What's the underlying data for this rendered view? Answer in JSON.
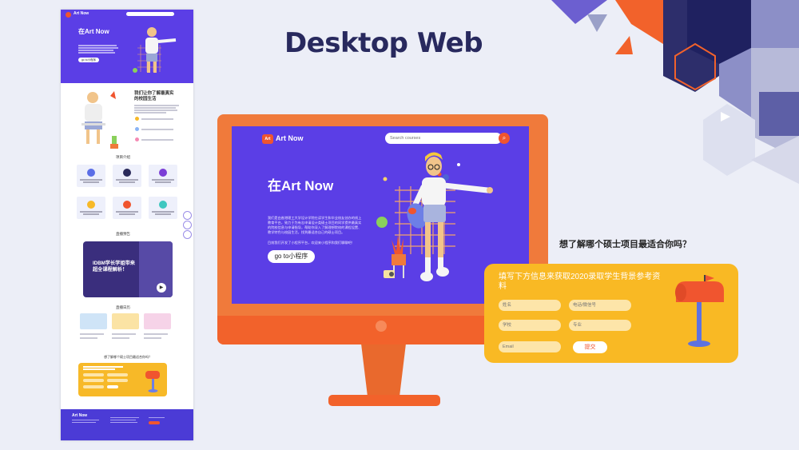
{
  "headline": "Desktop Web",
  "long_page": {
    "brand": "Art Now",
    "hero_title": "在Art Now",
    "hero_button": "go to小程序",
    "intro_title": "我们让你了解最真实的校园生活",
    "programs_title": "项目介绍",
    "live_title": "直播预告",
    "video_text_line1": "IDBM学长学姐带来",
    "video_text_line2": "超全课程解析！",
    "blog_title": "直播日历",
    "quiz_title": "想了解哪个硕士项目最适合你吗？",
    "footer_brand": "Art Now"
  },
  "screen": {
    "logo_text": "Art",
    "brand": "Art Now",
    "search_placeholder": "Search courses",
    "hero_title": "在Art Now",
    "hero_desc": "我们是由香港理工大学设计学院在读学生和毕业校友创办的线上教育平台，致力于为有志申请设计类硕士项目的同学提供最真实的院校信息与申请指导，帮助你深入了解理想院校的课程设置、教学特色与校园生活，找到最适合自己的硕士项目。",
    "hero_note": "目前我们开发了小程序平台，欢迎来小程序和我们聊聊吧！",
    "cta": "go to小程序"
  },
  "form": {
    "question": "想了解哪个硕士项目最适合你吗？",
    "title": "填写下方信息来获取2020录取学生背景参考资料",
    "name_placeholder": "姓名",
    "phone_placeholder": "电话/微信号",
    "school_placeholder": "学校",
    "major_placeholder": "专业",
    "email_placeholder": "Email",
    "submit": "提交"
  },
  "colors": {
    "purple": "#5b3ee6",
    "orange": "#f07a3b",
    "yellow": "#f9b924",
    "navy": "#28295e",
    "accent_red": "#f0552f"
  }
}
